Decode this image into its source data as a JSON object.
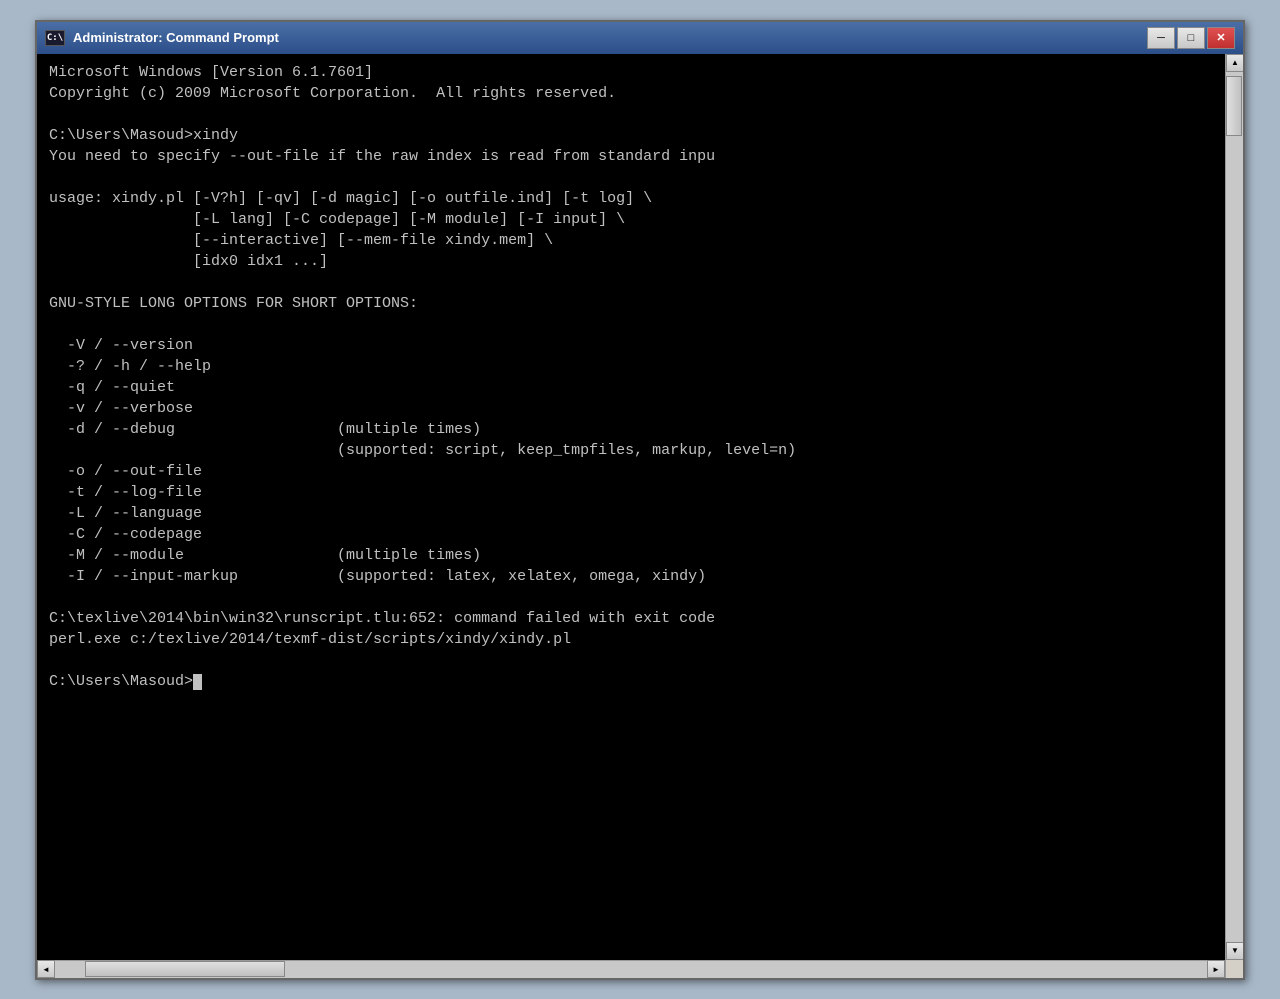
{
  "window": {
    "title": "Administrator: Command Prompt",
    "icon_label": "C:\\",
    "buttons": {
      "minimize": "─",
      "maximize": "□",
      "close": "✕"
    }
  },
  "terminal": {
    "lines": [
      "Microsoft Windows [Version 6.1.7601]",
      "Copyright (c) 2009 Microsoft Corporation.  All rights reserved.",
      "",
      "C:\\Users\\Masoud>xindy",
      "You need to specify --out-file if the raw index is read from standard inpu",
      "",
      "usage: xindy.pl [-V?h] [-qv] [-d magic] [-o outfile.ind] [-t log] \\",
      "                [-L lang] [-C codepage] [-M module] [-I input] \\",
      "                [--interactive] [--mem-file xindy.mem] \\",
      "                [idx0 idx1 ...]",
      "",
      "GNU-STYLE LONG OPTIONS FOR SHORT OPTIONS:",
      "",
      "  -V / --version",
      "  -? / -h / --help",
      "  -q / --quiet",
      "  -v / --verbose",
      "  -d / --debug                  (multiple times)",
      "                                (supported: script, keep_tmpfiles, markup, level=n)",
      "  -o / --out-file",
      "  -t / --log-file",
      "  -L / --language",
      "  -C / --codepage",
      "  -M / --module                 (multiple times)",
      "  -I / --input-markup           (supported: latex, xelatex, omega, xindy)",
      "",
      "C:\\texlive\\2014\\bin\\win32\\runscript.tlu:652: command failed with exit code",
      "perl.exe c:/texlive/2014/texmf-dist/scripts/xindy/xindy.pl",
      "",
      "C:\\Users\\Masoud>_"
    ]
  }
}
